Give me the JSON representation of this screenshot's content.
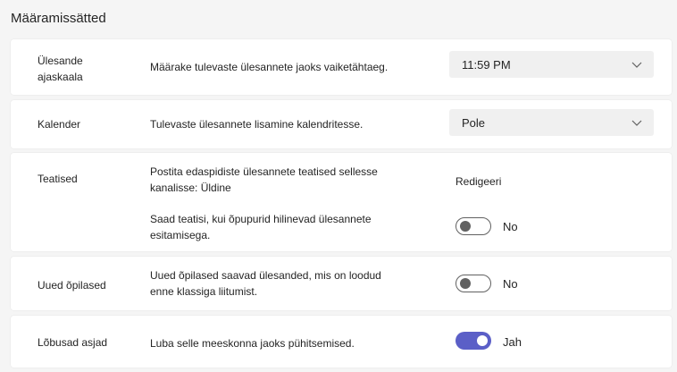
{
  "page": {
    "title": "Määramissätted"
  },
  "rows": [
    {
      "label": "Ülesande ajaskaala",
      "description": "Määrake tulevaste ülesannete jaoks vaiketähtaeg.",
      "control": {
        "type": "dropdown",
        "value": "11:59 PM",
        "icon": "chevron-down-icon"
      }
    },
    {
      "label": "Kalender",
      "description": "Tulevaste ülesannete lisamine kalendritesse.",
      "control": {
        "type": "dropdown",
        "value": "Pole",
        "icon": "chevron-down-icon"
      }
    },
    {
      "label": "Teatised",
      "description": "Postita edaspidiste ülesannete teatised sellesse kanalisse: Üldine",
      "link": "Redigeeri",
      "sub": {
        "description": "Saad teatisi, kui õpupurid hilinevad ülesannete esitamisega.",
        "toggle": {
          "state": "off",
          "label": "No"
        }
      }
    },
    {
      "label": "Uued õpilased",
      "description": "Uued õpilased saavad ülesanded, mis on loodud enne klassiga liitumist.",
      "toggle": {
        "state": "off",
        "label": "No"
      }
    },
    {
      "label": "Lõbusad asjad",
      "description": "Luba selle meeskonna jaoks pühitsemised.",
      "toggle": {
        "state": "on",
        "label": "Jah",
        "accent": "#5b5fc7"
      }
    }
  ]
}
